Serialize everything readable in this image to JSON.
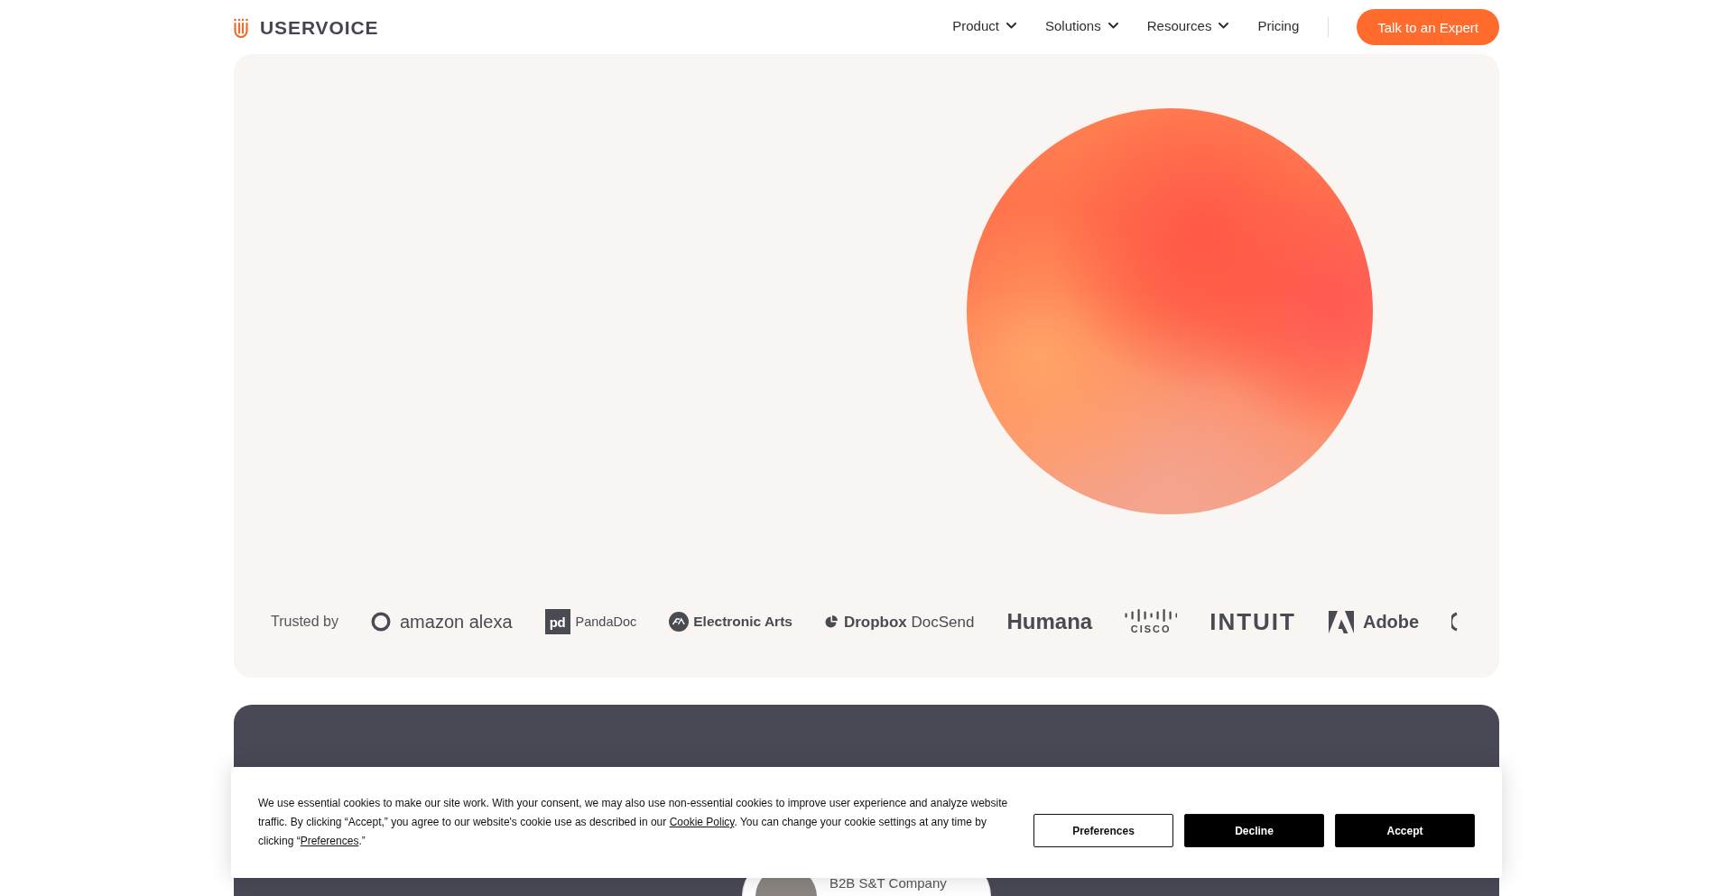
{
  "header": {
    "logo": {
      "text": "USERVOICE"
    },
    "nav": [
      {
        "label": "Product",
        "kind": "dropdown"
      },
      {
        "label": "Solutions",
        "kind": "dropdown"
      },
      {
        "label": "Resources",
        "kind": "dropdown"
      },
      {
        "label": "Pricing",
        "kind": "link"
      }
    ],
    "cta": "Talk to an Expert"
  },
  "hero": {
    "trusted_by": {
      "label": "Trusted by",
      "logos": [
        {
          "kind": "alexa",
          "name": "amazon alexa"
        },
        {
          "kind": "pandadoc",
          "mark": "pd",
          "name": "PandaDoc"
        },
        {
          "kind": "ea",
          "name": "Electronic Arts"
        },
        {
          "kind": "docsend",
          "name": "**Dropbox** DocSend"
        },
        {
          "kind": "humana",
          "name": "Humana"
        },
        {
          "kind": "cisco",
          "name": "CISCO"
        },
        {
          "kind": "intuit",
          "name": "INTUIT"
        },
        {
          "kind": "adobe",
          "name": "Adobe"
        },
        {
          "kind": "partial"
        }
      ]
    }
  },
  "testimonial": {
    "company": "B2B S&T Company"
  },
  "cookie_banner": {
    "message": [
      {
        "kind": "text",
        "text": "We use essential cookies to make our site work. With your consent, we may also use non-essential cookies to improve user experience and analyze website traffic. By clicking “Accept,” you agree to our website's cookie use as described in our "
      },
      {
        "kind": "link",
        "text": "Cookie Policy"
      },
      {
        "kind": "text",
        "text": ". You can change your cookie settings at any time by clicking “"
      },
      {
        "kind": "link",
        "text": "Preferences"
      },
      {
        "kind": "text",
        "text": ".”"
      }
    ],
    "buttons": [
      {
        "label": "Preferences",
        "kind": "outline"
      },
      {
        "label": "Decline",
        "kind": "solid"
      },
      {
        "label": "Accept",
        "kind": "solid"
      }
    ]
  }
}
